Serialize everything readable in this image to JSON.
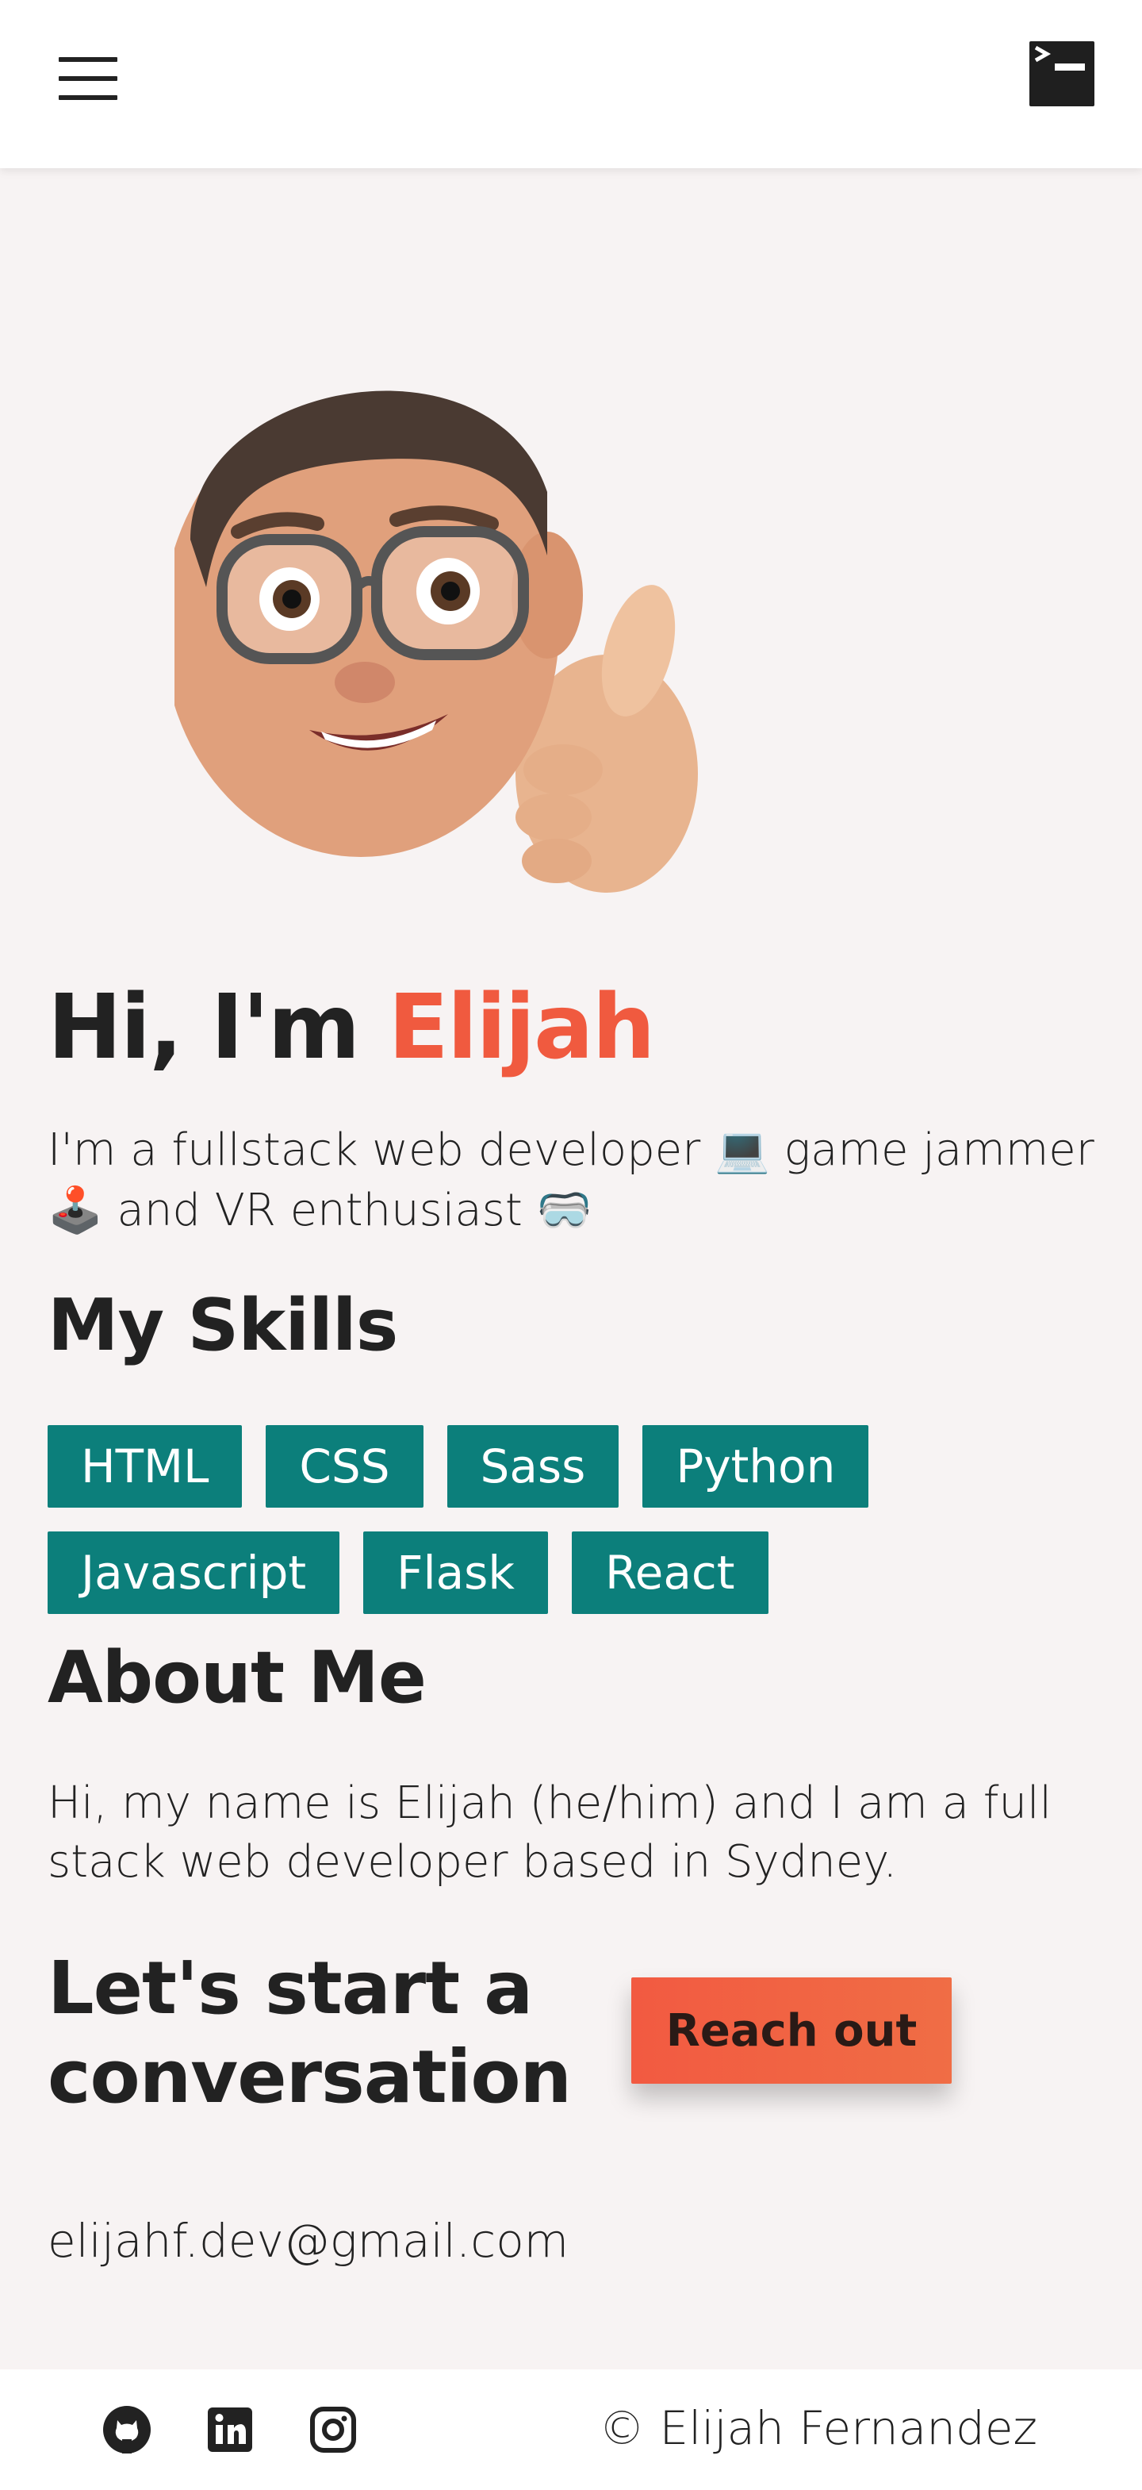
{
  "header": {
    "menu_icon": "hamburger-menu-icon",
    "logo_icon": "terminal-icon"
  },
  "hero": {
    "avatar": "memoji-thumbs-up",
    "greeting": "Hi, I'm ",
    "name": "Elijah",
    "subtitle": "I'm a fullstack web developer 💻 game jammer 🕹️ and VR enthusiast 🥽"
  },
  "skills": {
    "title": "My Skills",
    "row1": [
      "HTML",
      "CSS",
      "Sass",
      "Python"
    ],
    "row2": [
      "Javascript",
      "Flask",
      "React"
    ]
  },
  "about": {
    "title": "About Me",
    "text": "Hi, my name is Elijah (he/him) and I am a full stack web developer based in Sydney."
  },
  "contact": {
    "title": "Let's start a conversation",
    "button_label": "Reach out",
    "email": "elijahf.dev@gmail.com"
  },
  "footer": {
    "icons": [
      "github-icon",
      "linkedin-icon",
      "instagram-icon"
    ],
    "copyright": "© Elijah Fernandez"
  },
  "colors": {
    "accent": "#f05a3f",
    "skill_bg": "#0c7f7b",
    "page_bg": "#f7f3f3"
  }
}
